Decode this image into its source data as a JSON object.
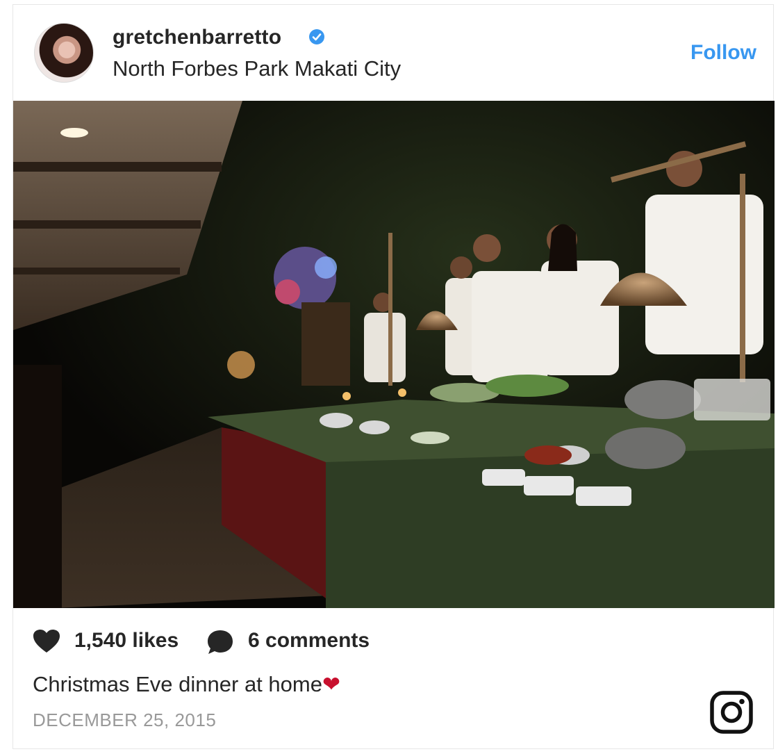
{
  "post": {
    "username": "gretchenbarretto",
    "location": "North Forbes Park Makati City",
    "follow_label": "Follow",
    "likes": "1,540 likes",
    "comments": "6 comments",
    "caption": "Christmas Eve dinner at home",
    "caption_emoji": "❤",
    "date": "DECEMBER 25, 2015"
  },
  "icons": {
    "verified": "verified-badge-icon",
    "like": "heart-icon",
    "comment": "comment-bubble-icon",
    "brand": "instagram-icon"
  },
  "colors": {
    "follow": "#3897f0",
    "text": "#262626",
    "muted": "#999999",
    "emoji_heart": "#c8102e",
    "verified": "#3897f0"
  }
}
